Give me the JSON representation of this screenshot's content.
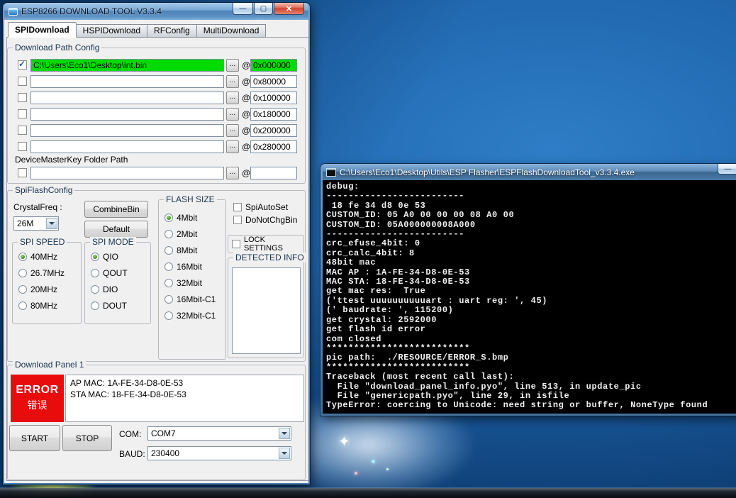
{
  "icons": {
    "minimize": "—",
    "maximize": "▢",
    "close": "✕",
    "check": "✓"
  },
  "esp_window": {
    "title": "ESP8266 DOWNLOAD TOOL V3.3.4",
    "tabs": [
      "SPIDownload",
      "HSPIDownload",
      "RFConfig",
      "MultiDownload"
    ],
    "download_path_config": {
      "group_label": "Download Path Config",
      "browse_label": "...",
      "at_label": "@",
      "rows": [
        {
          "checked": true,
          "path": "C:\\Users\\Eco1\\Desktop\\int.bin",
          "addr": "0x000000"
        },
        {
          "checked": false,
          "path": "",
          "addr": "0x80000"
        },
        {
          "checked": false,
          "path": "",
          "addr": "0x100000"
        },
        {
          "checked": false,
          "path": "",
          "addr": "0x180000"
        },
        {
          "checked": false,
          "path": "",
          "addr": "0x200000"
        },
        {
          "checked": false,
          "path": "",
          "addr": "0x280000"
        }
      ],
      "masterkey_label": "DeviceMasterKey Folder Path",
      "masterkey_row": {
        "checked": false,
        "path": "",
        "addr": ""
      }
    },
    "spi_flash_config": {
      "group_label": "SpiFlashConfig",
      "crystal_label": "CrystalFreq :",
      "crystal_value": "26M",
      "combine_button": "CombineBin",
      "default_button": "Default",
      "spi_speed": {
        "label": "SPI SPEED",
        "options": [
          "40MHz",
          "26.7MHz",
          "20MHz",
          "80MHz"
        ],
        "selected": "40MHz"
      },
      "spi_mode": {
        "label": "SPI MODE",
        "options": [
          "QIO",
          "QOUT",
          "DIO",
          "DOUT"
        ],
        "selected": "QIO"
      },
      "flash_size": {
        "label": "FLASH SIZE",
        "options": [
          "4Mbit",
          "2Mbit",
          "8Mbit",
          "16Mbit",
          "32Mbit",
          "16Mbit-C1",
          "32Mbit-C1"
        ],
        "selected": "4Mbit"
      },
      "spi_autoset_label": "SpiAutoSet",
      "do_not_chg_bin_label": "DoNotChgBin",
      "lock_settings_label": "LOCK SETTINGS",
      "detected_info_label": "DETECTED INFO"
    },
    "download_panel": {
      "group_label": "Download Panel 1",
      "status_text": "ERROR",
      "status_text_cn": "错误",
      "info_lines": [
        "AP MAC: 1A-FE-34-D8-0E-53",
        "STA MAC: 18-FE-34-D8-0E-53"
      ],
      "start_button": "START",
      "stop_button": "STOP",
      "com_label": "COM:",
      "com_value": "COM7",
      "baud_label": "BAUD:",
      "baud_value": "230400"
    }
  },
  "console_window": {
    "title": "C:\\Users\\Eco1\\Desktop\\Utils\\ESP Flasher\\ESPFlashDownloadTool_v3.3.4.exe",
    "lines": [
      "debug: ",
      "-------------------------",
      " 18 fe 34 d8 0e 53",
      "CUSTOM_ID: 05 A0 00 00 00 08 A0 00",
      "CUSTOM_ID: 05A000000008A000",
      "-------------------------",
      "crc_efuse_4bit: 0",
      "crc_calc_4bit: 8",
      "48bit mac",
      "MAC AP : 1A-FE-34-D8-0E-53",
      "MAC STA: 18-FE-34-D8-0E-53",
      "get mac res:  True",
      "('ttest uuuuuuuuuuart : uart reg: ', 45)",
      "(' baudrate: ', 115200)",
      "get crystal: 2592000",
      "get flash id error",
      "com closed",
      "**************************",
      "pic path:  ./RESOURCE/ERROR_S.bmp",
      "**************************",
      "Traceback (most recent call last):",
      "  File \"download_panel_info.pyo\", line 513, in update_pic",
      "  File \"genericpath.pyo\", line 29, in isfile",
      "TypeError: coercing to Unicode: need string or buffer, NoneType found"
    ]
  }
}
